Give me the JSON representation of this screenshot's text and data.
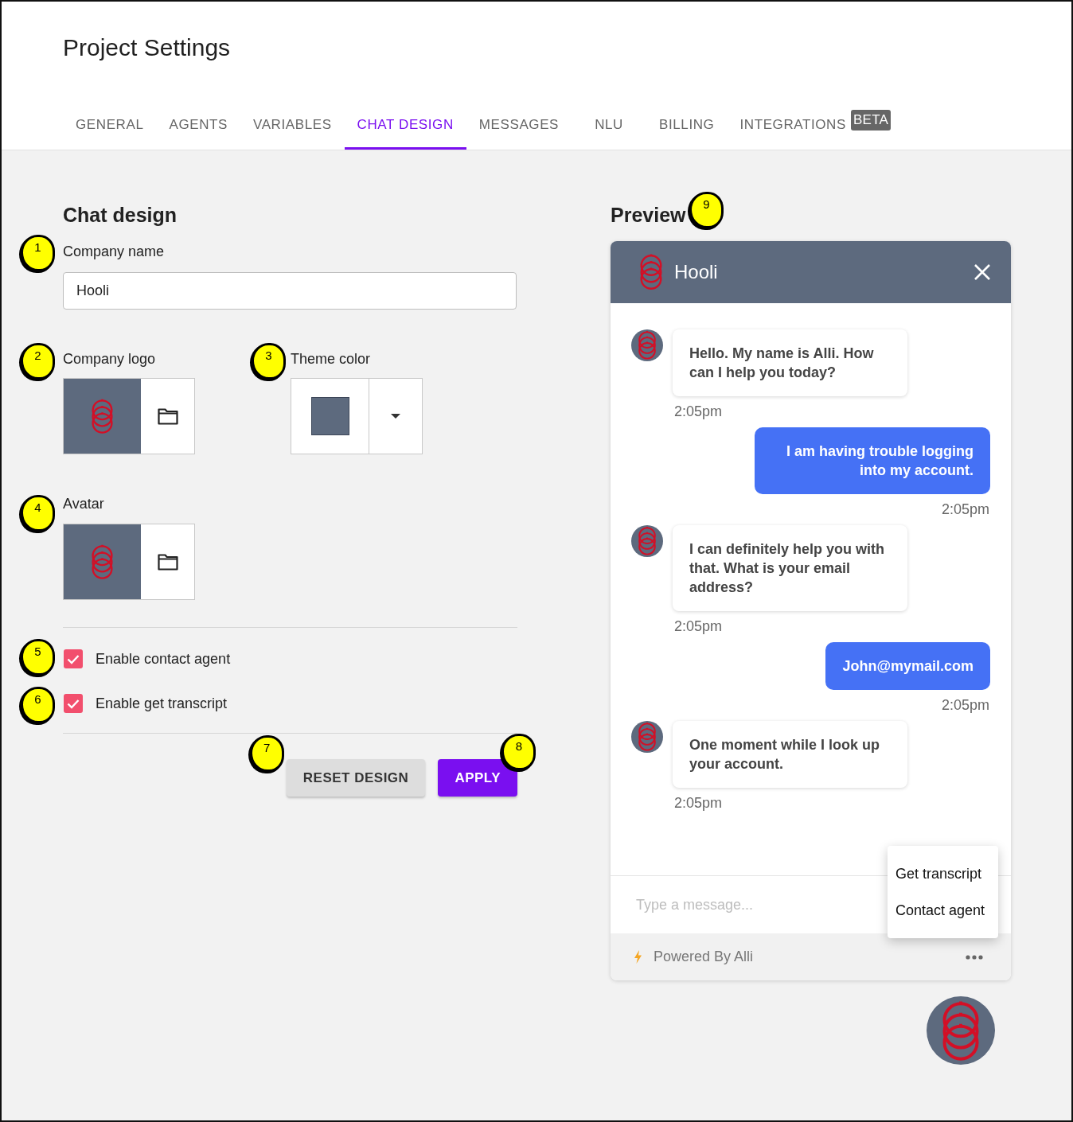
{
  "page": {
    "title": "Project Settings"
  },
  "tabs": [
    {
      "label": "GENERAL",
      "selected": false
    },
    {
      "label": "AGENTS",
      "selected": false
    },
    {
      "label": "VARIABLES",
      "selected": false
    },
    {
      "label": "CHAT DESIGN",
      "selected": true
    },
    {
      "label": "MESSAGES",
      "selected": false
    },
    {
      "label": "NLU",
      "selected": false
    },
    {
      "label": "BILLING",
      "selected": false
    },
    {
      "label": "INTEGRATIONS",
      "selected": false,
      "badge": "BETA"
    }
  ],
  "chat_design": {
    "heading": "Chat design",
    "company_name": {
      "callout": "1",
      "label": "Company name",
      "value": "Hooli"
    },
    "company_logo": {
      "callout": "2",
      "label": "Company logo"
    },
    "theme_color": {
      "callout": "3",
      "label": "Theme color",
      "color": "#5d6a7e"
    },
    "avatar": {
      "callout": "4",
      "label": "Avatar"
    },
    "options": [
      {
        "callout": "5",
        "label": "Enable contact agent",
        "checked": true
      },
      {
        "callout": "6",
        "label": "Enable get transcript",
        "checked": true
      }
    ],
    "buttons": [
      {
        "callout": "7",
        "label": "RESET DESIGN",
        "kind": "secondary"
      },
      {
        "callout": "8",
        "label": "APPLY",
        "kind": "primary"
      }
    ]
  },
  "preview": {
    "heading": "Preview",
    "callout": "9",
    "chat_title": "Hooli",
    "messages": [
      {
        "kind": "bot",
        "text": "Hello. My name is Alli. How can I help you today?",
        "time": "2:05pm"
      },
      {
        "kind": "user",
        "text": "I am having trouble logging into my account.",
        "time": "2:05pm"
      },
      {
        "kind": "bot",
        "text": "I can definitely help you with that. What is your email address?",
        "time": "2:05pm"
      },
      {
        "kind": "user",
        "text": "John@mymail.com",
        "time": "2:05pm"
      },
      {
        "kind": "bot",
        "text": "One moment while I look up your account.",
        "time": "2:05pm"
      }
    ],
    "message_input": {
      "placeholder": "Type a message..."
    },
    "menu": [
      "Get transcript",
      "Contact agent"
    ],
    "footer": "Powered By Alli"
  }
}
